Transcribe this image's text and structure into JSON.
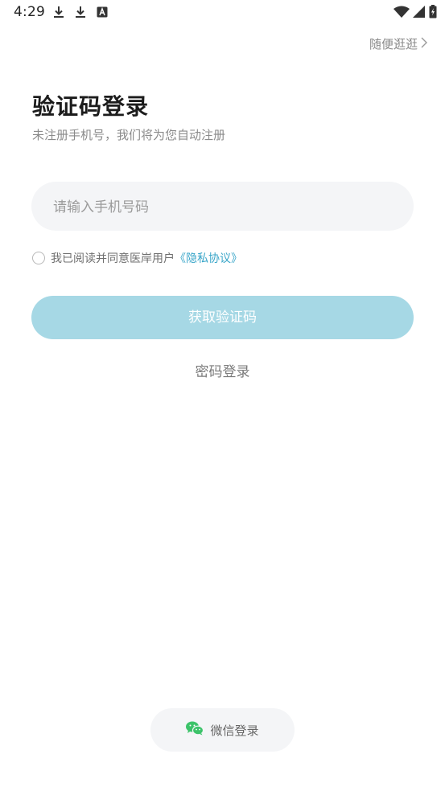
{
  "status_bar": {
    "time": "4:29",
    "left_icons": [
      "download-icon",
      "download-icon",
      "a-notification-icon"
    ],
    "right_icons": [
      "wifi-icon",
      "signal-icon",
      "battery-charging-icon"
    ]
  },
  "header": {
    "skip_label": "随便逛逛",
    "skip_icon": "chevron-right-icon"
  },
  "main": {
    "title": "验证码登录",
    "subtitle": "未注册手机号，我们将为您自动注册",
    "phone_placeholder": "请输入手机号码",
    "phone_value": "",
    "agreement_text": "我已阅读并同意医岸用户",
    "agreement_link": "《隐私协议》",
    "agreement_checked": false,
    "get_code_label": "获取验证码",
    "password_login_label": "密码登录"
  },
  "footer": {
    "wechat_label": "微信登录",
    "wechat_icon": "wechat-icon"
  },
  "colors": {
    "accent": "#3aa6c9",
    "button_disabled": "#a6d8e5",
    "wechat_green": "#3cc36a",
    "input_bg": "#f4f5f7"
  }
}
